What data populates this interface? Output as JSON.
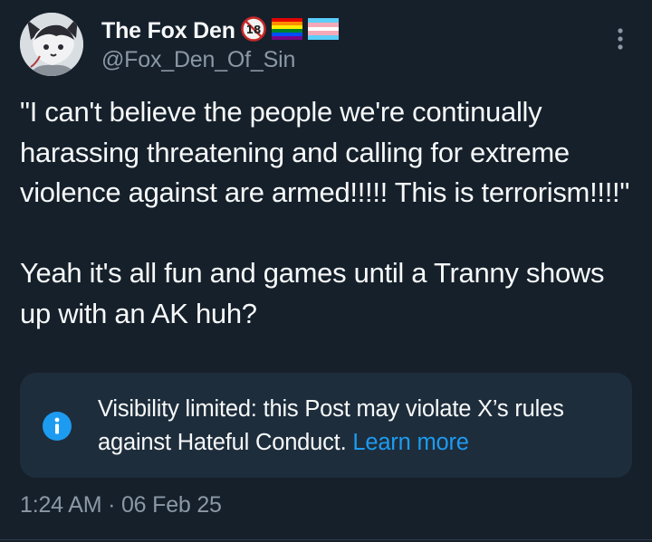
{
  "author": {
    "display_name": "The Fox Den",
    "handle": "@Fox_Den_Of_Sin",
    "age_badge_text": "18",
    "avatar_icon": "fox-avatar",
    "flags": [
      "rainbow-pride-flag",
      "transgender-pride-flag"
    ]
  },
  "post": {
    "text": "\"I can't believe the people we're continually harassing threatening and calling for extreme violence against are armed!!!!! This is terrorism!!!!\"\n\nYeah it's all fun and games until a Tranny shows up with an AK huh?",
    "menu_icon": "more-vertical-icon"
  },
  "notice": {
    "icon": "info-icon",
    "text": "Visibility limited: this Post may violate X’s rules against Hateful Conduct.",
    "link": "Learn more"
  },
  "meta": {
    "time": "1:24 AM",
    "separator": "·",
    "date": "06 Feb 25"
  },
  "colors": {
    "background": "#15202b",
    "text": "#f7f9f9",
    "secondary": "#8b98a5",
    "notice_bg": "#1e2d3c",
    "accent": "#1d9bf0"
  }
}
